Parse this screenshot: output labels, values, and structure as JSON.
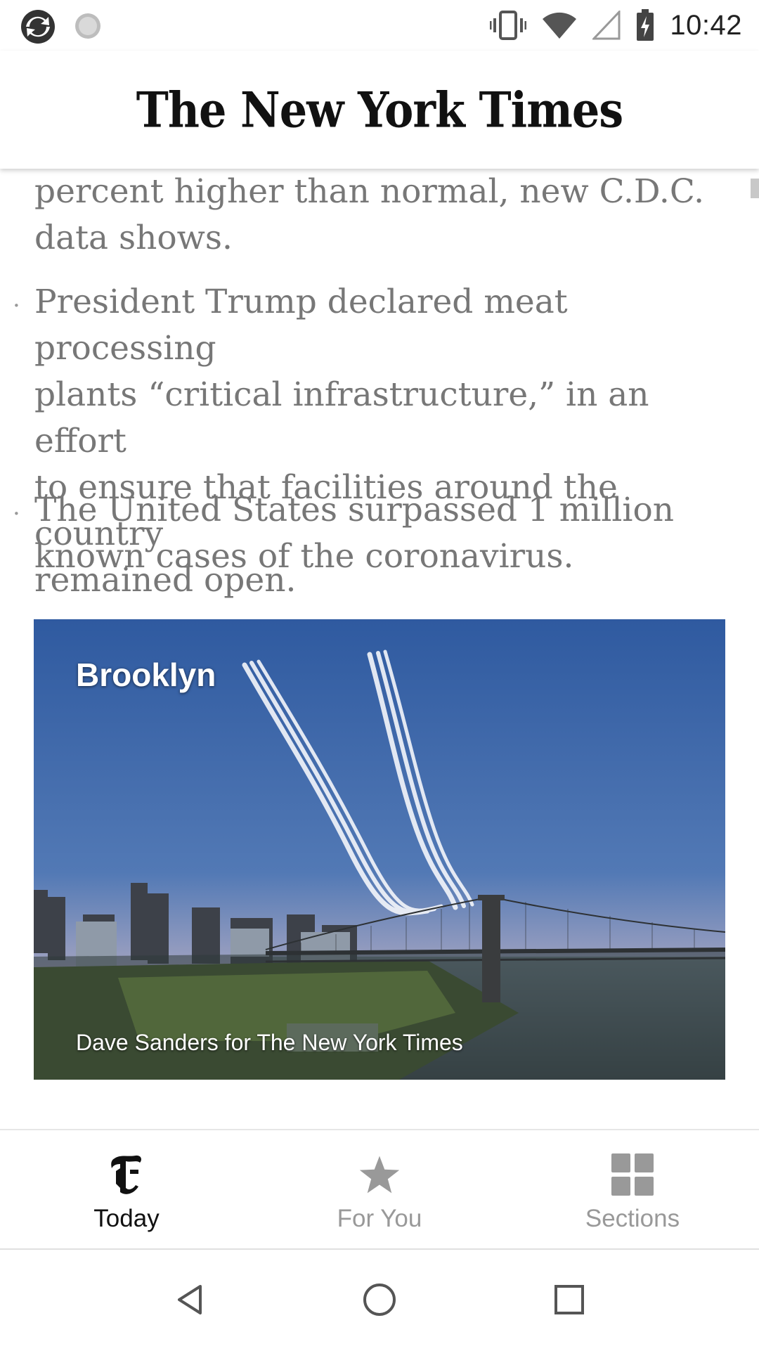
{
  "status_bar": {
    "time": "10:42",
    "icons": [
      "app-sync-icon",
      "loading-icon",
      "vibrate-icon",
      "wifi-icon",
      "cell-signal-icon",
      "battery-charging-icon"
    ]
  },
  "header": {
    "title": "The New York Times"
  },
  "article": {
    "clipped_top_line": "percent higher than normal, new C.D.C.",
    "bullets": [
      {
        "lines": [
          "percent higher than normal, new C.D.C.",
          "data shows."
        ],
        "bullet": ""
      },
      {
        "lines": [
          "President Trump declared meat processing",
          "plants “critical infrastructure,” in an effort",
          "to ensure that facilities around the country",
          "remained open."
        ],
        "bullet": "·"
      },
      {
        "lines": [
          "The United States surpassed 1 million",
          "known cases of the coronavirus."
        ],
        "bullet": "·"
      }
    ],
    "photo": {
      "label": "Brooklyn",
      "credit": "Dave Sanders for The New York Times"
    }
  },
  "tabs": [
    {
      "label": "Today",
      "icon": "nyt-t-logo-icon",
      "active": true
    },
    {
      "label": "For You",
      "icon": "star-icon",
      "active": false
    },
    {
      "label": "Sections",
      "icon": "grid-icon",
      "active": false
    }
  ],
  "colors": {
    "active_tab": "#111111",
    "inactive_tab": "#999999",
    "body_text": "#777777"
  },
  "system_nav": [
    "back-icon",
    "home-icon",
    "recents-icon"
  ]
}
